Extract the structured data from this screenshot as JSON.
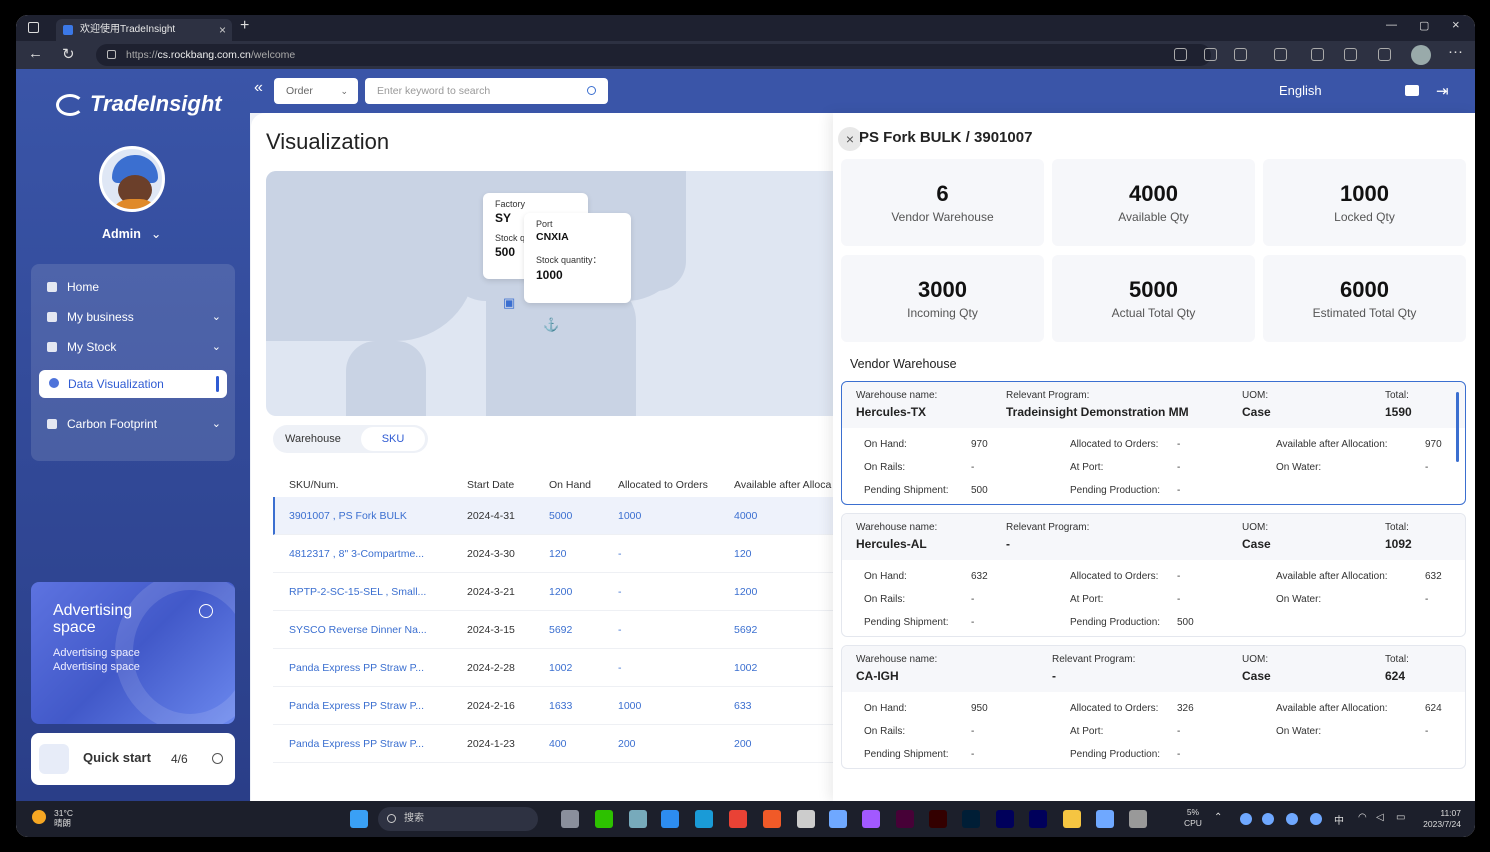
{
  "browser": {
    "tab_title": "欢迎使用TradeInsight",
    "url_prefix": "https://",
    "url_host": "cs.rockbang.com.cn",
    "url_path": "/welcome"
  },
  "app": {
    "logo_text": "TradeInsight",
    "user_name": "Admin",
    "menu": [
      {
        "label": "Home",
        "icon": "home-icon"
      },
      {
        "label": "My business",
        "icon": "briefcase-icon"
      },
      {
        "label": "My Stock",
        "icon": "stock-icon"
      },
      {
        "label": "Data Visualization",
        "icon": "pie-chart-icon"
      },
      {
        "label": "Carbon Footprint",
        "icon": "cloud-icon"
      }
    ],
    "ad": {
      "title": "Advertising space",
      "subtitle": "Advertising space Advertising space"
    },
    "quick_start": {
      "label": "Quick start",
      "count": "4/6"
    },
    "topbar": {
      "order_select": "Order",
      "search_placeholder": "Enter keyword to search",
      "language": "English"
    }
  },
  "main": {
    "title": "Visualization",
    "map": {
      "factory_label": "Factory",
      "factory_value": "SY",
      "factory_stock_label": "Stock quantity",
      "factory_stock_value": "500",
      "port_label": "Port",
      "port_value": "CNXIA",
      "port_stock_label": "Stock quantity：",
      "port_stock_value": "1000"
    },
    "toggle": {
      "warehouse": "Warehouse",
      "sku": "SKU"
    },
    "table": {
      "headers": [
        "SKU/Num.",
        "Start Date",
        "On Hand",
        "Allocated to Orders",
        "Available after Alloca"
      ],
      "rows": [
        [
          "3901007 , PS Fork BULK",
          "2024-4-31",
          "5000",
          "1000",
          "4000"
        ],
        [
          "4812317 , 8\" 3-Compartme...",
          "2024-3-30",
          "120",
          "-",
          "120"
        ],
        [
          "RPTP-2-SC-15-SEL , Small...",
          "2024-3-21",
          "1200",
          "-",
          "1200"
        ],
        [
          "SYSCO Reverse Dinner Na...",
          "2024-3-15",
          "5692",
          "-",
          "5692"
        ],
        [
          "Panda Express PP Straw P...",
          "2024-2-28",
          "1002",
          "-",
          "1002"
        ],
        [
          "Panda Express PP Straw P...",
          "2024-2-16",
          "1633",
          "1000",
          "633"
        ],
        [
          "Panda Express PP Straw P...",
          "2024-1-23",
          "400",
          "200",
          "200"
        ]
      ]
    }
  },
  "panel": {
    "title": "PS Fork BULK / 3901007",
    "stats": [
      {
        "value": "6",
        "label": "Vendor Warehouse"
      },
      {
        "value": "4000",
        "label": "Available Qty"
      },
      {
        "value": "1000",
        "label": "Locked Qty"
      },
      {
        "value": "3000",
        "label": "Incoming Qty"
      },
      {
        "value": "5000",
        "label": "Actual Total Qty"
      },
      {
        "value": "6000",
        "label": "Estimated Total Qty"
      }
    ],
    "section_title": "Vendor Warehouse",
    "labels": {
      "warehouse_name": "Warehouse name:",
      "relevant_program": "Relevant Program:",
      "uom": "UOM:",
      "total": "Total:",
      "on_hand": "On Hand:",
      "allocated": "Allocated to Orders:",
      "available": "Available after Allocation:",
      "on_rails": "On Rails:",
      "at_port": "At Port:",
      "on_water": "On Water:",
      "pending_shipment": "Pending Shipment:",
      "pending_production": "Pending Production:"
    },
    "warehouses": [
      {
        "name": "Hercules-TX",
        "program": "Tradeinsight Demonstration MM",
        "uom": "Case",
        "total": "1590",
        "on_hand": "970",
        "allocated": "-",
        "available": "970",
        "on_rails": "-",
        "at_port": "-",
        "on_water": "-",
        "pending_shipment": "500",
        "pending_production": "-"
      },
      {
        "name": "Hercules-AL",
        "program": "-",
        "uom": "Case",
        "total": "1092",
        "on_hand": "632",
        "allocated": "-",
        "available": "632",
        "on_rails": "-",
        "at_port": "-",
        "on_water": "-",
        "pending_shipment": "-",
        "pending_production": "500"
      },
      {
        "name": "CA-IGH",
        "program": "-",
        "uom": "Case",
        "total": "624",
        "on_hand": "950",
        "allocated": "326",
        "available": "624",
        "on_rails": "-",
        "at_port": "-",
        "on_water": "-",
        "pending_shipment": "-",
        "pending_production": "-"
      }
    ]
  },
  "taskbar": {
    "temp": "31°C",
    "weather": "晴朗",
    "search": "搜索",
    "cpu_pct": "5%",
    "cpu_label": "CPU",
    "ime": "中",
    "time": "11:07",
    "date": "2023/7/24"
  },
  "colors": {
    "brand": "#3a55a8",
    "accent": "#3b6fd0"
  }
}
